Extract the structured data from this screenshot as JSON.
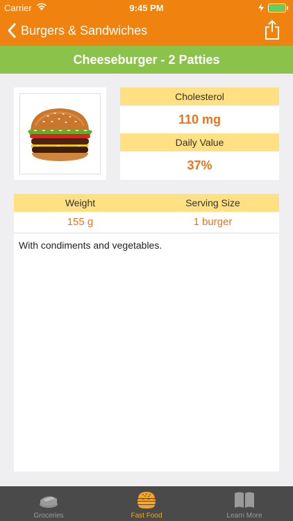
{
  "status": {
    "carrier": "Carrier",
    "time": "9:45 PM"
  },
  "nav": {
    "back_label": "Burgers & Sandwiches"
  },
  "title": "Cheeseburger - 2 Patties",
  "nutrient": {
    "label": "Cholesterol",
    "value": "110 mg",
    "daily_label": "Daily Value",
    "daily_value": "37%"
  },
  "details": {
    "columns": [
      "Weight",
      "Serving Size"
    ],
    "values": [
      "155 g",
      "1 burger"
    ],
    "description": "With condiments and vegetables."
  },
  "tabs": [
    {
      "label": "Groceries",
      "icon": "groceries-icon",
      "active": false
    },
    {
      "label": "Fast Food",
      "icon": "burger-icon",
      "active": true
    },
    {
      "label": "Learn More",
      "icon": "book-icon",
      "active": false
    }
  ],
  "colors": {
    "nav": "#f0820f",
    "title": "#8bc34a",
    "header": "#ffe083",
    "value": "#e8741b",
    "tab_active": "#f6a623",
    "tabbar": "#4a4a4a"
  }
}
